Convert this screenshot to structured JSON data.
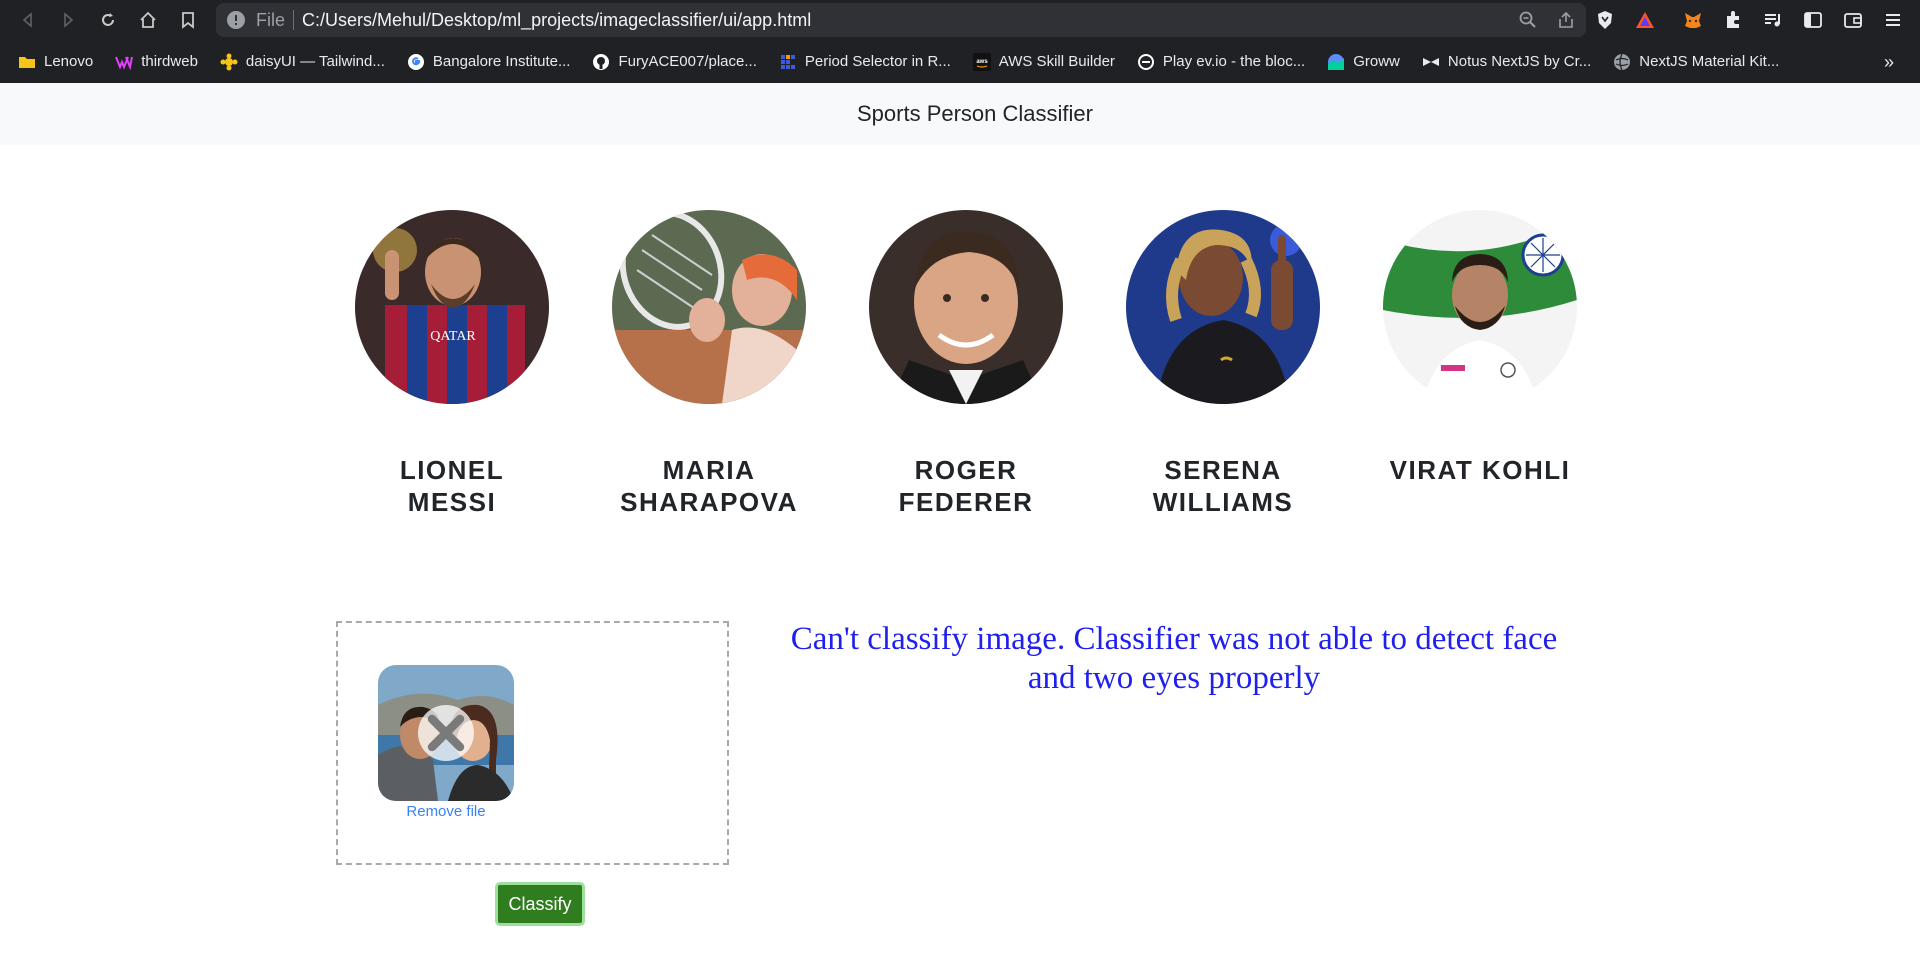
{
  "browser": {
    "url_scheme": "File",
    "url": "C:/Users/Mehul/Desktop/ml_projects/imageclassifier/ui/app.html"
  },
  "bookmarks": [
    {
      "label": "Lenovo",
      "icon": "folder-icon",
      "color": "#f5c518"
    },
    {
      "label": "thirdweb",
      "icon": "thirdweb-icon",
      "color": "#e040fb"
    },
    {
      "label": "daisyUI — Tailwind...",
      "icon": "daisyui-icon",
      "color": "#f5c518"
    },
    {
      "label": "Bangalore Institute...",
      "icon": "google-icon",
      "color": "#ffffff"
    },
    {
      "label": "FuryACE007/place...",
      "icon": "github-icon",
      "color": "#ffffff"
    },
    {
      "label": "Period Selector in R...",
      "icon": "grid-icon",
      "color": "#3b5bdb"
    },
    {
      "label": "AWS Skill Builder",
      "icon": "aws-icon",
      "color": "#111111"
    },
    {
      "label": "Play ev.io - the bloc...",
      "icon": "evio-icon",
      "color": "#ffffff"
    },
    {
      "label": "Groww",
      "icon": "groww-icon",
      "color": "#5f8bff"
    },
    {
      "label": "Notus NextJS by Cr...",
      "icon": "bow-icon",
      "color": "#111111"
    },
    {
      "label": "NextJS Material Kit...",
      "icon": "globe-icon",
      "color": "#9aa0a6"
    }
  ],
  "navbar": {
    "brand": "Sports Person Classifier"
  },
  "players": [
    {
      "name": "LIONEL MESSI"
    },
    {
      "name": "MARIA SHARAPOVA"
    },
    {
      "name": "ROGER FEDERER"
    },
    {
      "name": "SERENA WILLIAMS"
    },
    {
      "name": "VIRAT KOHLI"
    }
  ],
  "upload": {
    "remove_label": "Remove file"
  },
  "classify_label": "Classify",
  "result": {
    "error_message": "Can't classify image. Classifier was not able to detect face and two eyes properly"
  },
  "colors": {
    "error_text": "#1f1fee",
    "classify_button": "#2f7d1f",
    "link": "#3b82f6"
  }
}
